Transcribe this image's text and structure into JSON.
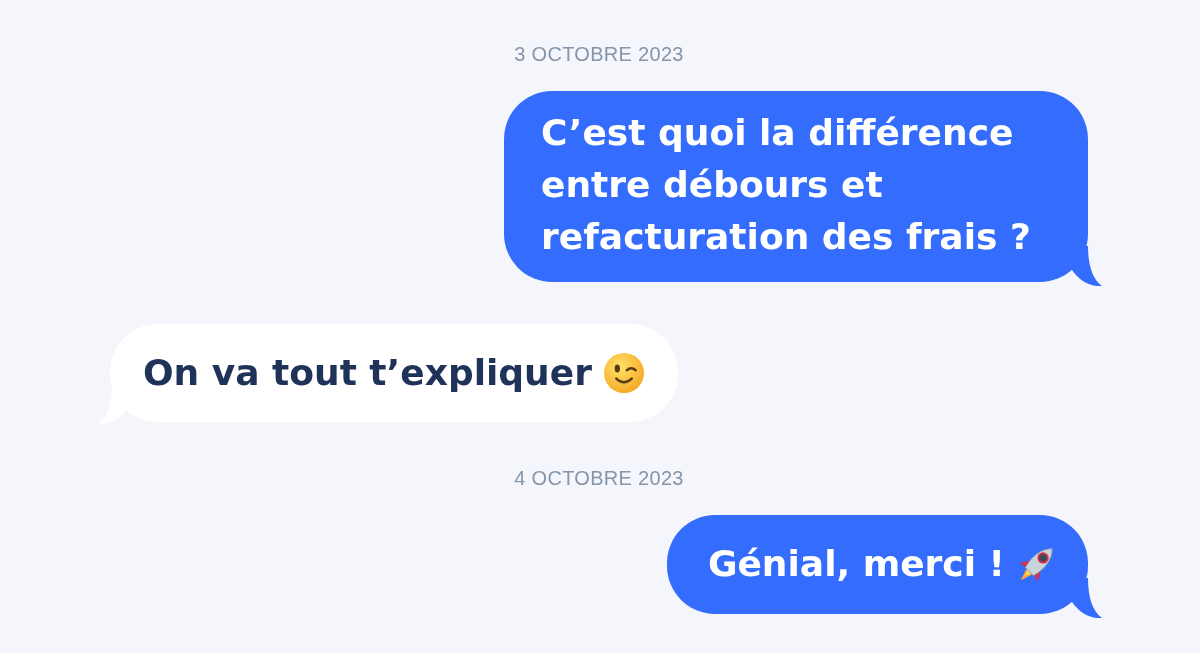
{
  "conversation": [
    {
      "kind": "date",
      "text": "3 OCTOBRE 2023"
    },
    {
      "kind": "sent",
      "text": "C’est quoi la différence entre débours et refacturation des frais ?"
    },
    {
      "kind": "received",
      "text": "On va tout t’expliquer",
      "emoji": {
        "kind": "wink"
      }
    },
    {
      "kind": "date",
      "text": "4 OCTOBRE 2023"
    },
    {
      "kind": "sent",
      "text": "Génial, merci !",
      "emoji": {
        "kind": "rocket"
      }
    }
  ]
}
